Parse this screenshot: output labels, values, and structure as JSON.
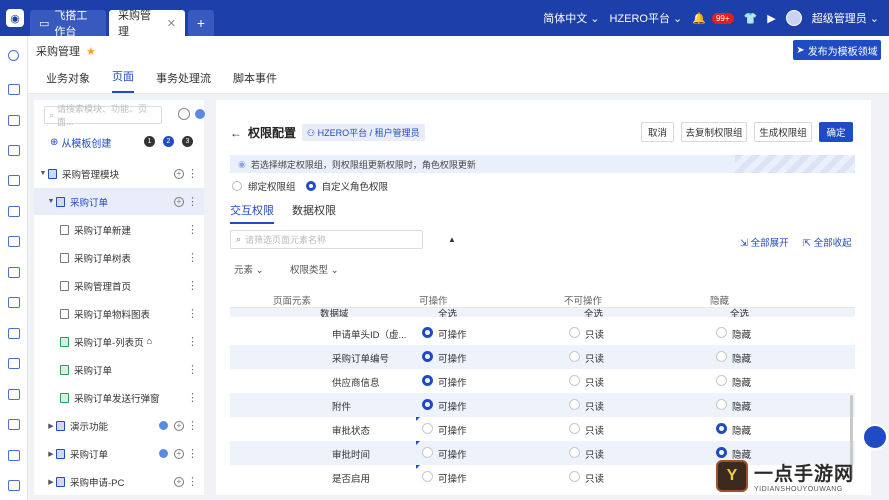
{
  "topbar": {
    "tabs": [
      {
        "label": "飞搭工作台"
      },
      {
        "label": "采购管理"
      }
    ],
    "add_tab": "+",
    "language": "简体中文",
    "platform": "HZERO平台",
    "notify_count": "99+",
    "user": "超级管理员"
  },
  "page": {
    "title": "采购管理",
    "publish_button": "发布为模板领域",
    "subtabs": [
      "业务对象",
      "页面",
      "事务处理流",
      "脚本事件"
    ],
    "active_subtab": "页面"
  },
  "tree": {
    "search_placeholder": "请搜索模块、功能、页面...",
    "create_label": "从模板创建",
    "step_numbers": [
      "1",
      "2",
      "3"
    ],
    "items": [
      {
        "label": "采购管理模块",
        "level": 0
      },
      {
        "label": "采购订单",
        "level": 1,
        "selected": true
      },
      {
        "label": "采购订单新建",
        "level": 2
      },
      {
        "label": "采购订单树表",
        "level": 2
      },
      {
        "label": "采购管理首页",
        "level": 2
      },
      {
        "label": "采购订单物料图表",
        "level": 2
      },
      {
        "label": "采购订单-列表页",
        "level": 2
      },
      {
        "label": "采购订单",
        "level": 2
      },
      {
        "label": "采购订单发送行弹窗",
        "level": 2
      },
      {
        "label": "演示功能",
        "level": 1
      },
      {
        "label": "采购订单",
        "level": 1
      },
      {
        "label": "采购申请-PC",
        "level": 1
      }
    ]
  },
  "main": {
    "title": "权限配置",
    "breadcrumb": "HZERO平台 / 租户管理员",
    "buttons": {
      "cancel": "取消",
      "copy": "去复制权限组",
      "generate": "生成权限组",
      "confirm": "确定"
    },
    "notice": "若选择绑定权限组，则权限组更新权限时，角色权限更新",
    "radio_options": [
      "绑定权限组",
      "自定义角色权限"
    ],
    "radio_selected": "自定义角色权限",
    "perm_tabs": [
      "交互权限",
      "数据权限"
    ],
    "active_perm_tab": "交互权限",
    "search_placeholder": "请筛选页面元素名称",
    "expand_all": "全部展开",
    "collapse_all": "全部收起",
    "filters": [
      "元素",
      "权限类型"
    ],
    "columns": [
      "页面元素",
      "可操作",
      "不可操作",
      "隐藏"
    ],
    "clipped_row": {
      "name": "数据域",
      "operable": "全选",
      "inoperable": "全选",
      "hidden": "全选"
    },
    "rows": [
      {
        "name": "申请单头ID（虚...",
        "state": "operable"
      },
      {
        "name": "采购订单编号",
        "state": "operable"
      },
      {
        "name": "供应商信息",
        "state": "operable"
      },
      {
        "name": "附件",
        "state": "operable"
      },
      {
        "name": "审批状态",
        "state": "hidden"
      },
      {
        "name": "审批时间",
        "state": "hidden"
      },
      {
        "name": "是否启用",
        "state": "none"
      }
    ],
    "option_labels": {
      "operable": "可操作",
      "inoperable": "只读",
      "hidden": "隐藏"
    }
  },
  "watermark": {
    "title": "一点手游网",
    "sub": "YIDIANSHOUYOUWANG"
  },
  "colors": {
    "brand": "#1c3faa",
    "primary": "#1f4bc4",
    "star": "#f5a623",
    "badge": "#e02020"
  }
}
